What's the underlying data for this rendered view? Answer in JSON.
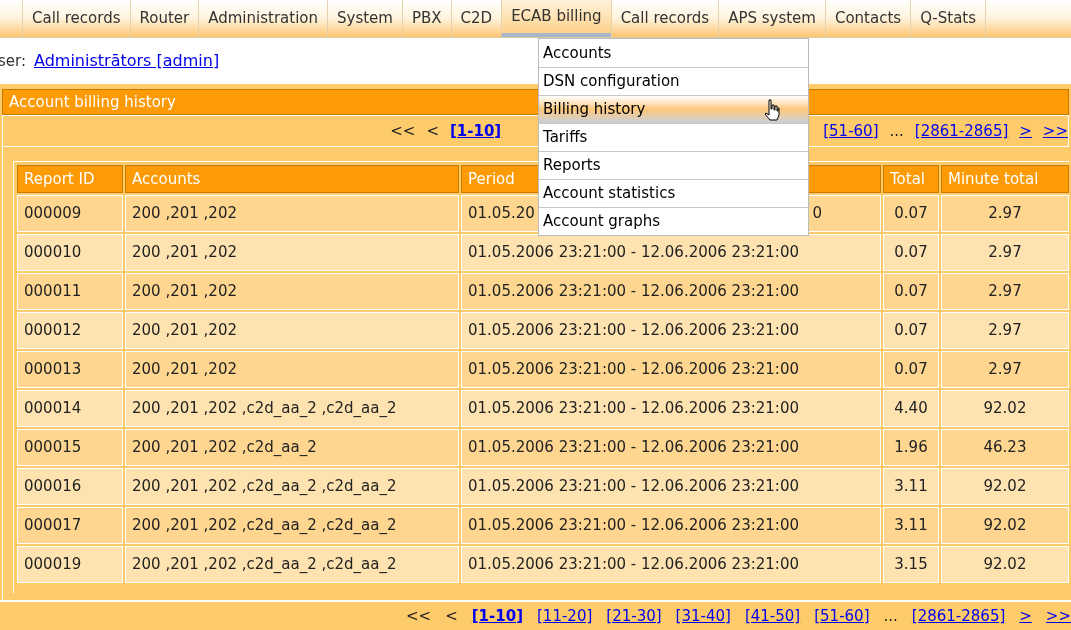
{
  "nav": [
    {
      "label": "Call records",
      "selected": false
    },
    {
      "label": "Router",
      "selected": false
    },
    {
      "label": "Administration",
      "selected": false
    },
    {
      "label": "System",
      "selected": false
    },
    {
      "label": "PBX",
      "selected": false
    },
    {
      "label": "C2D",
      "selected": false
    },
    {
      "label": "ECAB billing",
      "selected": true
    },
    {
      "label": "Call records",
      "selected": false
    },
    {
      "label": "APS system",
      "selected": false
    },
    {
      "label": "Contacts",
      "selected": false
    },
    {
      "label": "Q-Stats",
      "selected": false
    }
  ],
  "menu": [
    {
      "label": "Accounts",
      "selected": false
    },
    {
      "label": "DSN configuration",
      "selected": false
    },
    {
      "label": "Billing history",
      "selected": true
    },
    {
      "label": "Tariffs",
      "selected": false
    },
    {
      "label": "Reports",
      "selected": false
    },
    {
      "label": "Account statistics",
      "selected": false
    },
    {
      "label": "Account graphs",
      "selected": false
    }
  ],
  "user": {
    "label": "ser:",
    "name": "Administrātors [admin]"
  },
  "panel_title": "Account billing history",
  "pager_top": [
    {
      "label": "<<",
      "kind": "plain"
    },
    {
      "label": "<",
      "kind": "plain"
    },
    {
      "label": "[1-10]",
      "kind": "link",
      "selected": true
    },
    {
      "kind": "covered"
    },
    {
      "label": "[51-60]",
      "kind": "link",
      "selected": false
    },
    {
      "label": "...",
      "kind": "plain"
    },
    {
      "label": "[2861-2865]",
      "kind": "link",
      "selected": false
    },
    {
      "label": ">",
      "kind": "link",
      "selected": false
    },
    {
      "label": ">>",
      "kind": "link",
      "selected": false
    }
  ],
  "table": {
    "columns": [
      "Report ID",
      "Accounts",
      "Period",
      "Total",
      "Minute total"
    ],
    "rows": [
      [
        "000009",
        "200 ,201 ,202",
        [
          "01.05.20",
          "0"
        ],
        "0.07",
        "2.97"
      ],
      [
        "000010",
        "200 ,201 ,202",
        "01.05.2006 23:21:00 - 12.06.2006 23:21:00",
        "0.07",
        "2.97"
      ],
      [
        "000011",
        "200 ,201 ,202",
        "01.05.2006 23:21:00 - 12.06.2006 23:21:00",
        "0.07",
        "2.97"
      ],
      [
        "000012",
        "200 ,201 ,202",
        "01.05.2006 23:21:00 - 12.06.2006 23:21:00",
        "0.07",
        "2.97"
      ],
      [
        "000013",
        "200 ,201 ,202",
        "01.05.2006 23:21:00 - 12.06.2006 23:21:00",
        "0.07",
        "2.97"
      ],
      [
        "000014",
        "200 ,201 ,202 ,c2d_aa_2 ,c2d_aa_2",
        "01.05.2006 23:21:00 - 12.06.2006 23:21:00",
        "4.40",
        "92.02"
      ],
      [
        "000015",
        "200 ,201 ,202 ,c2d_aa_2",
        "01.05.2006 23:21:00 - 12.06.2006 23:21:00",
        "1.96",
        "46.23"
      ],
      [
        "000016",
        "200 ,201 ,202 ,c2d_aa_2 ,c2d_aa_2",
        "01.05.2006 23:21:00 - 12.06.2006 23:21:00",
        "3.11",
        "92.02"
      ],
      [
        "000017",
        "200 ,201 ,202 ,c2d_aa_2 ,c2d_aa_2",
        "01.05.2006 23:21:00 - 12.06.2006 23:21:00",
        "3.11",
        "92.02"
      ],
      [
        "000019",
        "200 ,201 ,202 ,c2d_aa_2 ,c2d_aa_2",
        "01.05.2006 23:21:00 - 12.06.2006 23:21:00",
        "3.15",
        "92.02"
      ]
    ]
  },
  "pager_bottom": [
    {
      "label": "<<",
      "kind": "plain"
    },
    {
      "label": "<",
      "kind": "plain"
    },
    {
      "label": "[1-10]",
      "kind": "link",
      "selected": true
    },
    {
      "label": "[11-20]",
      "kind": "link",
      "selected": false
    },
    {
      "label": "[21-30]",
      "kind": "link",
      "selected": false
    },
    {
      "label": "[31-40]",
      "kind": "link",
      "selected": false
    },
    {
      "label": "[41-50]",
      "kind": "link",
      "selected": false
    },
    {
      "label": "[51-60]",
      "kind": "link",
      "selected": false
    },
    {
      "label": "...",
      "kind": "plain"
    },
    {
      "label": "[2861-2865]",
      "kind": "link",
      "selected": false
    },
    {
      "label": ">",
      "kind": "link",
      "selected": false
    },
    {
      "label": ">>",
      "kind": "link",
      "selected": false
    }
  ]
}
